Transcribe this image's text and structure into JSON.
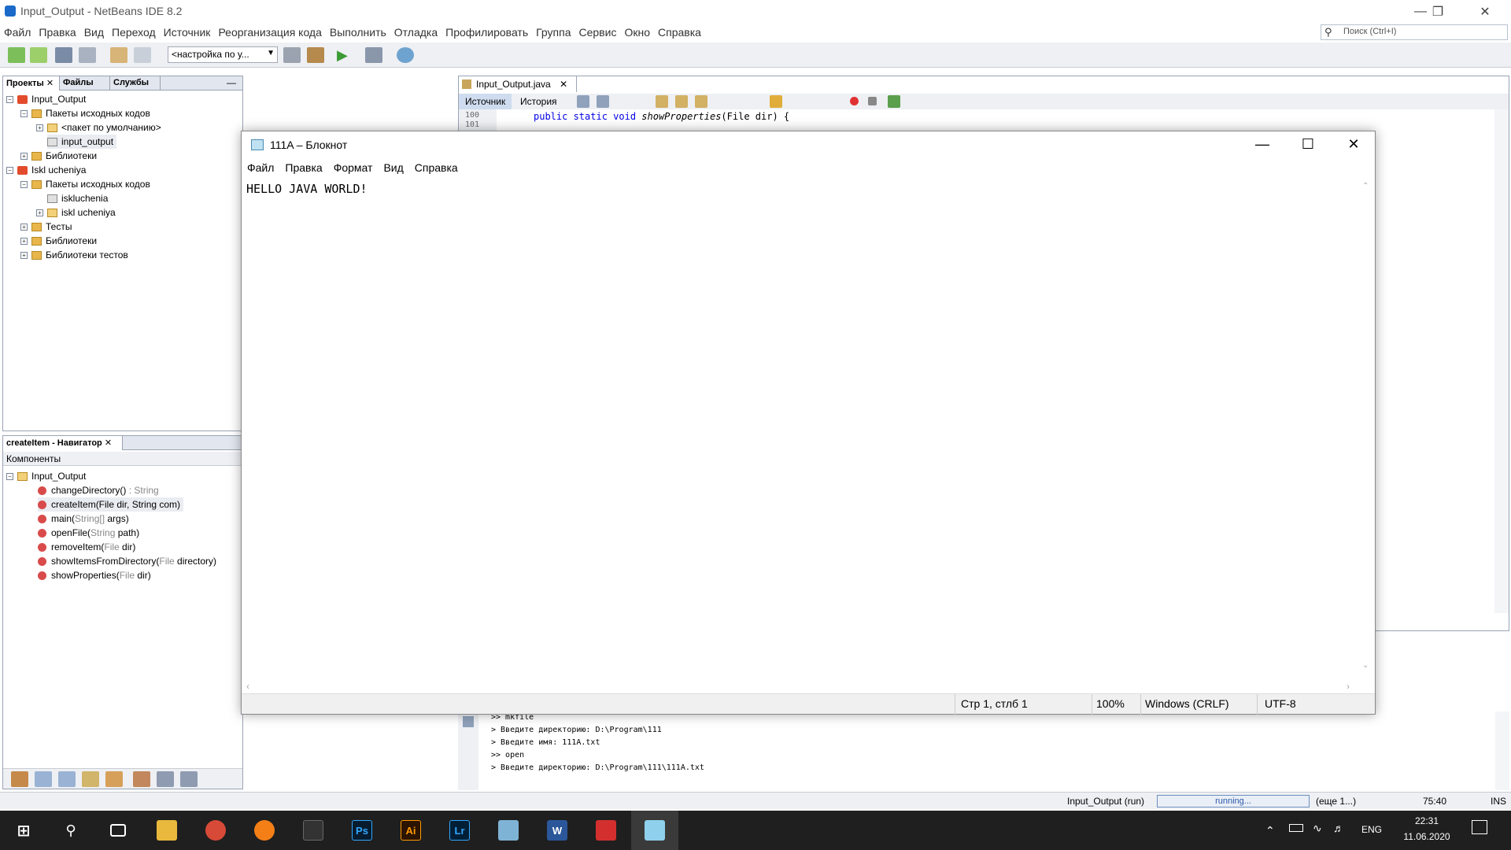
{
  "netbeans": {
    "window_title": "Input_Output - NetBeans IDE 8.2",
    "menu": [
      "Файл",
      "Правка",
      "Вид",
      "Переход",
      "Источник",
      "Реорганизация кода",
      "Выполнить",
      "Отладка",
      "Профилировать",
      "Группа",
      "Сервис",
      "Окно",
      "Справка"
    ],
    "search_placeholder": "Поиск (Ctrl+I)",
    "config_select": "<настройка по у..."
  },
  "projects_panel": {
    "tabs": [
      "Проекты",
      "Файлы",
      "Службы"
    ],
    "tree": [
      {
        "label": "Input_Output",
        "level": 0,
        "icon": "project-icon",
        "expanded": true
      },
      {
        "label": "Пакеты исходных кодов",
        "level": 1,
        "icon": "folder-icon",
        "expanded": true
      },
      {
        "label": "<пакет по умолчанию>",
        "level": 2,
        "icon": "package-icon",
        "expanded": false
      },
      {
        "label": "input_output",
        "level": 2,
        "icon": "package-icon",
        "selected": true
      },
      {
        "label": "Библиотеки",
        "level": 1,
        "icon": "folder-icon",
        "expanded": false
      },
      {
        "label": "Iskl ucheniya",
        "level": 0,
        "icon": "project-icon",
        "expanded": true
      },
      {
        "label": "Пакеты исходных кодов",
        "level": 1,
        "icon": "folder-icon",
        "expanded": true
      },
      {
        "label": "iskluchenia",
        "level": 2,
        "icon": "package-icon"
      },
      {
        "label": "iskl ucheniya",
        "level": 2,
        "icon": "package-icon",
        "expanded": false
      },
      {
        "label": "Тесты",
        "level": 1,
        "icon": "folder-icon",
        "expanded": false
      },
      {
        "label": "Библиотеки",
        "level": 1,
        "icon": "folder-icon",
        "expanded": false
      },
      {
        "label": "Библиотеки тестов",
        "level": 1,
        "icon": "folder-icon",
        "expanded": false
      }
    ]
  },
  "navigator": {
    "tab": "createItem - Навигатор",
    "subheader": "Компоненты",
    "root": "Input_Output",
    "methods": [
      {
        "name": "changeDirectory()",
        "suffix": " : String",
        "params": ""
      },
      {
        "name": "createItem(File dir, String com)",
        "suffix": "",
        "params": "",
        "selected": true
      },
      {
        "name": "main(",
        "params": "String[]",
        "after": " args)"
      },
      {
        "name": "openFile(",
        "params": "String",
        "after": " path)"
      },
      {
        "name": "removeItem(",
        "params": "File",
        "after": " dir)"
      },
      {
        "name": "showItemsFromDirectory(",
        "params": "File",
        "after": " directory)"
      },
      {
        "name": "showProperties(",
        "params": "File",
        "after": " dir)"
      }
    ]
  },
  "editor": {
    "tab": "Input_Output.java",
    "source_btn": "Источник",
    "history_btn": "История",
    "line_numbers": [
      "100",
      "101"
    ],
    "code_keywords": "public static void",
    "code_method": " showProperties",
    "code_rest": "(File dir) {"
  },
  "output": {
    "lines": [
      ">> mkfile",
      "> Введите директорию: D:\\Program\\111",
      "> Введите имя: 111A.txt",
      ">> open",
      "> Введите директорию: D:\\Program\\111\\111A.txt"
    ]
  },
  "notepad": {
    "title": "111A – Блокнот",
    "menu": [
      "Файл",
      "Правка",
      "Формат",
      "Вид",
      "Справка"
    ],
    "content": "HELLO JAVA WORLD!",
    "status": {
      "position": "Стр 1, стлб 1",
      "zoom": "100%",
      "line_ending": "Windows (CRLF)",
      "encoding": "UTF-8"
    }
  },
  "status_bar": {
    "task": "Input_Output (run)",
    "progress_text": "running...",
    "more": "(еще 1...)",
    "position": "75:40",
    "mode": "INS"
  },
  "taskbar": {
    "apps": [
      "windows-start-icon",
      "search-icon",
      "task-view-icon",
      "file-explorer-icon",
      "chrome-icon",
      "firefox-icon",
      "netbeans-icon",
      "photoshop-icon",
      "illustrator-icon",
      "lightroom-icon",
      "virtualbox-icon",
      "word-icon",
      "acrobat-icon",
      "notepad-icon"
    ],
    "ps_label": "Ps",
    "ai_label": "Ai",
    "lr_label": "Lr",
    "word_label": "W",
    "lang": "ENG",
    "time": "22:31",
    "date": "11.06.2020"
  },
  "colors": {
    "ide_toolbar": "#eef0f4",
    "taskbar": "#1f1f1f",
    "code_keyword": "#0000e6"
  }
}
